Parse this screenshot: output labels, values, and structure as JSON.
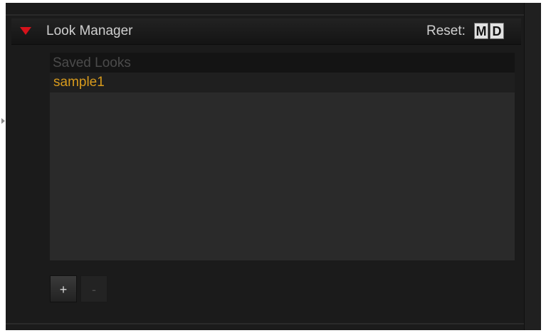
{
  "panel": {
    "title": "Look Manager",
    "expanded": true,
    "reset_label": "Reset:",
    "reset_buttons": [
      "M",
      "D"
    ]
  },
  "list": {
    "header": "Saved Looks",
    "items": [
      {
        "label": "sample1",
        "selected": true
      }
    ]
  },
  "toolbar": {
    "add_label": "+",
    "remove_label": "-"
  },
  "colors": {
    "accent_disclosure": "#d6121b",
    "item_text": "#d79a1c",
    "background": "#1b1b1b"
  },
  "icons": {
    "disclosure": "triangle-down-icon",
    "side_handle": "caret-right-icon"
  }
}
